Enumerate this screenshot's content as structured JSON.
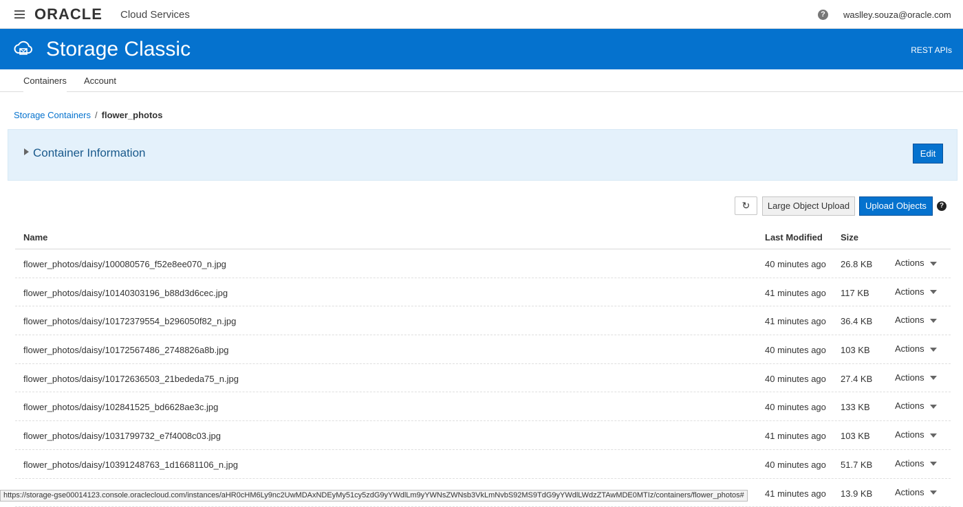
{
  "topbar": {
    "brand": "ORACLE",
    "brand_suffix": "Cloud Services",
    "help": "?",
    "user": "waslley.souza@oracle.com"
  },
  "banner": {
    "title": "Storage Classic",
    "rest_link": "REST APIs"
  },
  "tabs": [
    {
      "label": "Containers"
    },
    {
      "label": "Account"
    }
  ],
  "breadcrumb": {
    "parent": "Storage Containers",
    "separator": "/",
    "current": "flower_photos"
  },
  "info_panel": {
    "title": "Container Information",
    "edit_label": "Edit"
  },
  "toolbar": {
    "refresh": "↻",
    "large_upload": "Large Object Upload",
    "upload": "Upload Objects",
    "help": "?"
  },
  "table": {
    "headers": {
      "name": "Name",
      "modified": "Last Modified",
      "size": "Size"
    },
    "rows": [
      {
        "name": "flower_photos/daisy/100080576_f52e8ee070_n.jpg",
        "modified": "40 minutes ago",
        "size": "26.8 KB",
        "action": "Actions"
      },
      {
        "name": "flower_photos/daisy/10140303196_b88d3d6cec.jpg",
        "modified": "41 minutes ago",
        "size": "117 KB",
        "action": "Actions"
      },
      {
        "name": "flower_photos/daisy/10172379554_b296050f82_n.jpg",
        "modified": "41 minutes ago",
        "size": "36.4 KB",
        "action": "Actions"
      },
      {
        "name": "flower_photos/daisy/10172567486_2748826a8b.jpg",
        "modified": "40 minutes ago",
        "size": "103 KB",
        "action": "Actions"
      },
      {
        "name": "flower_photos/daisy/10172636503_21bededa75_n.jpg",
        "modified": "40 minutes ago",
        "size": "27.4 KB",
        "action": "Actions"
      },
      {
        "name": "flower_photos/daisy/102841525_bd6628ae3c.jpg",
        "modified": "40 minutes ago",
        "size": "133 KB",
        "action": "Actions"
      },
      {
        "name": "flower_photos/daisy/1031799732_e7f4008c03.jpg",
        "modified": "41 minutes ago",
        "size": "103 KB",
        "action": "Actions"
      },
      {
        "name": "flower_photos/daisy/10391248763_1d16681106_n.jpg",
        "modified": "40 minutes ago",
        "size": "51.7 KB",
        "action": "Actions"
      },
      {
        "name": "",
        "modified": "41 minutes ago",
        "size": "13.9 KB",
        "action": "Actions"
      }
    ]
  },
  "status_bar": {
    "url": "https://storage-gse00014123.console.oraclecloud.com/instances/aHR0cHM6Ly9nc2UwMDAxNDEyMy51cy5zdG9yYWdlLm9yYWNsZWNsb3VkLmNvbS92MS9TdG9yYWdlLWdzZTAwMDE0MTIz/containers/flower_photos#"
  }
}
